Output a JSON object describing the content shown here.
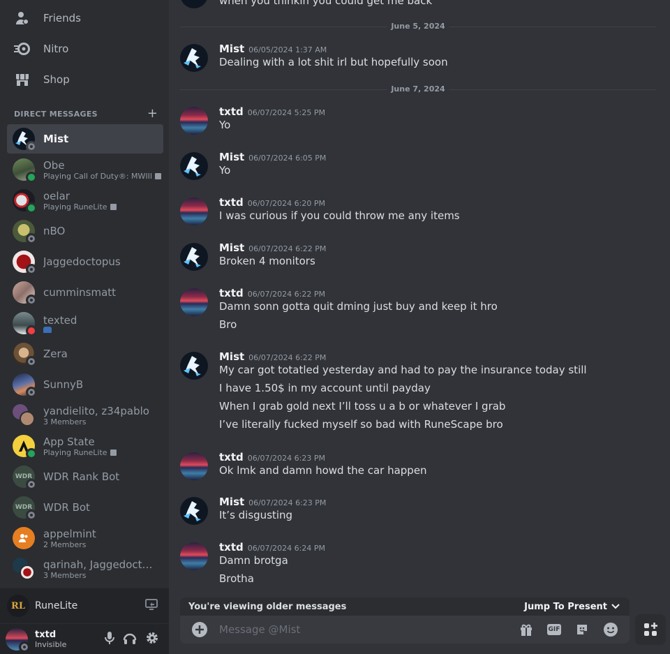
{
  "sidebar": {
    "nav": [
      {
        "label": "Friends",
        "icon": "friends-icon"
      },
      {
        "label": "Nitro",
        "icon": "nitro-icon"
      },
      {
        "label": "Shop",
        "icon": "shop-icon"
      }
    ],
    "dm_header": "DIRECT MESSAGES",
    "dms": [
      {
        "name": "Mist",
        "sub": "",
        "status": "offline",
        "active": true
      },
      {
        "name": "Obe",
        "sub": "Playing Call of Duty®: MWIII",
        "status": "online"
      },
      {
        "name": "oelar",
        "sub": "Playing RuneLite",
        "status": "online"
      },
      {
        "name": "nBO",
        "sub": "",
        "status": "offline"
      },
      {
        "name": "Jaggedoctopus",
        "sub": "",
        "status": "offline"
      },
      {
        "name": "cumminsmatt",
        "sub": "",
        "status": "offline"
      },
      {
        "name": "texted",
        "sub": "",
        "status": "dnd"
      },
      {
        "name": "Zera",
        "sub": "",
        "status": "offline"
      },
      {
        "name": "SunnyB",
        "sub": "",
        "status": "offline"
      },
      {
        "name": "yandielito, z34pablo",
        "sub": "3 Members",
        "status": "group"
      },
      {
        "name": "App State",
        "sub": "Playing RuneLite",
        "status": "online"
      },
      {
        "name": "WDR Rank Bot",
        "sub": "",
        "status": "offline"
      },
      {
        "name": "WDR Bot",
        "sub": "",
        "status": "offline"
      },
      {
        "name": "appelmint",
        "sub": "2 Members",
        "status": "group"
      },
      {
        "name": "qarinah, Jaggedoctop...",
        "sub": "3 Members",
        "status": "group"
      }
    ],
    "activity": {
      "name": "RuneLite",
      "logo": "RL"
    },
    "user": {
      "name": "txtd",
      "status": "Invisible"
    }
  },
  "chat": {
    "partial_top": "when you thinkin you could get me back",
    "dates": [
      "June 5, 2024",
      "June 7, 2024"
    ],
    "groups": [
      {
        "author": "Mist",
        "time": "06/05/2024 1:37 AM",
        "lines": [
          "Dealing with a lot shit irl but hopefully soon"
        ]
      },
      {
        "author": "txtd",
        "time": "06/07/2024 5:25 PM",
        "lines": [
          "Yo"
        ]
      },
      {
        "author": "Mist",
        "time": "06/07/2024 6:05 PM",
        "lines": [
          "Yo"
        ]
      },
      {
        "author": "txtd",
        "time": "06/07/2024 6:20 PM",
        "lines": [
          "I was curious if you could throw me any items"
        ]
      },
      {
        "author": "Mist",
        "time": "06/07/2024 6:22 PM",
        "lines": [
          "Broken 4 monitors"
        ]
      },
      {
        "author": "txtd",
        "time": "06/07/2024 6:22 PM",
        "lines": [
          "Damn sonn gotta quit dming just buy and keep it hro",
          "Bro"
        ]
      },
      {
        "author": "Mist",
        "time": "06/07/2024 6:22 PM",
        "lines": [
          "My car got totatled yesterday and had to pay the insurance today still",
          "I have 1.50$ in my account until payday",
          "When I grab gold next I’ll toss u a b or whatever I grab",
          "I’ve literally fucked myself so bad with RuneScape bro"
        ]
      },
      {
        "author": "txtd",
        "time": "06/07/2024 6:23 PM",
        "lines": [
          "Ok lmk and damn howd the car happen"
        ]
      },
      {
        "author": "Mist",
        "time": "06/07/2024 6:23 PM",
        "lines": [
          "It’s disgusting"
        ]
      },
      {
        "author": "txtd",
        "time": "06/07/2024 6:24 PM",
        "lines": [
          "Damn brotga",
          "Brotha"
        ]
      }
    ],
    "older_notice": "You're viewing older messages",
    "jump_label": "Jump To Present",
    "input_placeholder": "Message @Mist",
    "gif_label": "GIF"
  },
  "colors": {
    "bg_main": "#313338",
    "bg_sidebar": "#2b2d31",
    "online": "#23a55a",
    "dnd": "#f23f43"
  }
}
